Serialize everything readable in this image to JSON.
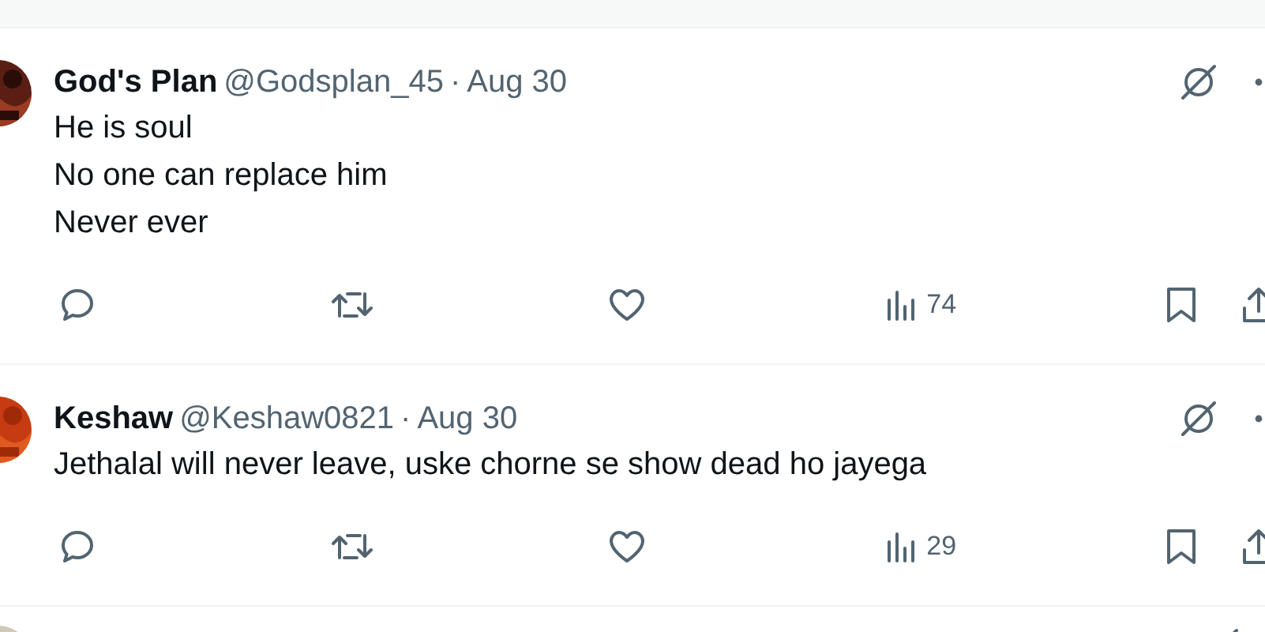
{
  "replies": [
    {
      "kind": "full",
      "name": "God's Plan",
      "handle": "@Godsplan_45",
      "separator": "·",
      "date": "Aug 30",
      "lines": [
        "He is soul",
        "No one can replace him",
        "Never ever"
      ],
      "views": "74"
    },
    {
      "kind": "full",
      "name": "Keshaw",
      "handle": "@Keshaw0821",
      "separator": "·",
      "date": "Aug 30",
      "lines": [
        "Jethalal will never leave, uske chorne se show dead ho jayega"
      ],
      "views": "29"
    },
    {
      "kind": "cut"
    }
  ]
}
